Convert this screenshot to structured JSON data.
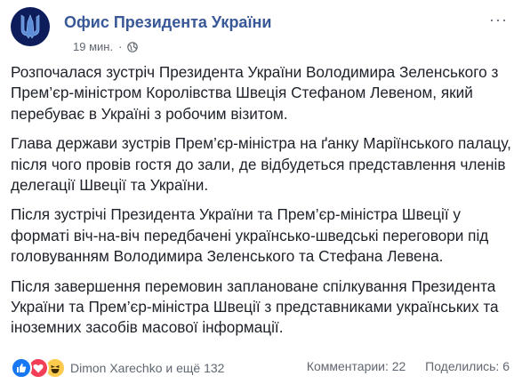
{
  "page": {
    "name": "Офис Президента України",
    "avatar": "coat-of-arms-avatar"
  },
  "meta": {
    "time": "19 мин.",
    "separator": "·",
    "privacy_icon": "globe-icon"
  },
  "more_menu": {
    "label": "···"
  },
  "body": {
    "paragraphs": [
      "Розпочалася зустріч Президента України Володимира Зеленського з Прем’єр-міністром Королівства Швеція Стефаном Левеном, який перебуває в Україні з робочим візитом.",
      "Глава держави зустрів Прем’єр-міністра на ґанку Маріїнського палацу, після чого провів гостя до зали, де відбудеться представлення членів делегації Швеції та України.",
      "Після зустрічі Президента України та Прем’єр-міністра Швеції у форматі віч-на-віч передбачені українсько-шведські переговори під головуванням Володимира Зеленського та Стефана Левена.",
      "Після завершення перемовин заплановане спілкування Президента України та Прем’єр-міністра Швеції з представниками українських та іноземних засобів масової інформації."
    ]
  },
  "footer": {
    "reaction_icons": [
      "like-icon",
      "love-icon",
      "haha-icon"
    ],
    "reactors": "Dimon Xarechko и ещё 132",
    "comments": "Комментарии: 22",
    "shares": "Поделились: 6"
  },
  "colors": {
    "link": "#385898",
    "text": "#1d2129",
    "muted": "#606770",
    "like": "#1877f2",
    "love": "#f33e58",
    "haha": "#fcca4d",
    "avatar_bg": "#0d1d5c"
  }
}
